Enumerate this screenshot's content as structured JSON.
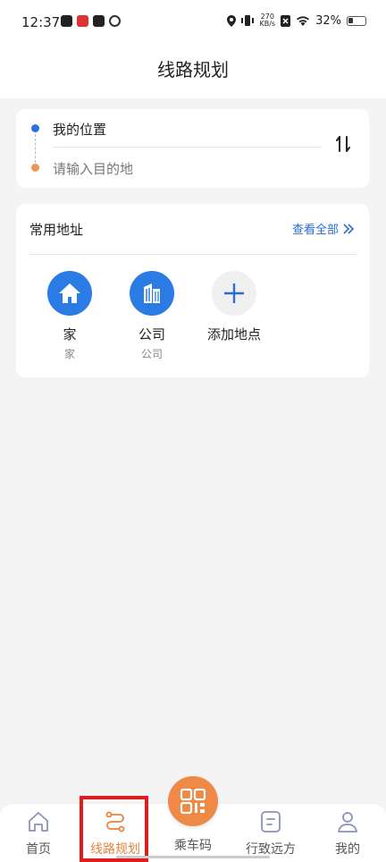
{
  "status_bar": {
    "time": "12:37",
    "speed_value": "270",
    "speed_unit": "KB/s",
    "battery": "32%",
    "battery_level": 0.32
  },
  "header": {
    "title": "线路规划"
  },
  "route": {
    "from_label": "我的位置",
    "to_placeholder": "请输入目的地",
    "swap_glyph": "⇅"
  },
  "common_addresses": {
    "title": "常用地址",
    "view_all": "查看全部",
    "places": [
      {
        "name": "家",
        "sub": "家",
        "icon": "home-icon"
      },
      {
        "name": "公司",
        "sub": "公司",
        "icon": "building-icon"
      },
      {
        "name": "添加地点",
        "sub": "",
        "icon": "plus-icon"
      }
    ]
  },
  "nav": {
    "items": [
      {
        "label": "首页",
        "icon": "home-outline-icon"
      },
      {
        "label": "线路规划",
        "icon": "route-icon",
        "active": true
      },
      {
        "label": "乘车码",
        "icon": "qr-code-icon"
      },
      {
        "label": "行致远方",
        "icon": "document-icon"
      },
      {
        "label": "我的",
        "icon": "user-icon"
      }
    ]
  },
  "colors": {
    "accent": "#e8843e",
    "link_blue": "#2a6bd4",
    "place_blue": "#2a7be4",
    "highlight": "#e01c1c"
  }
}
